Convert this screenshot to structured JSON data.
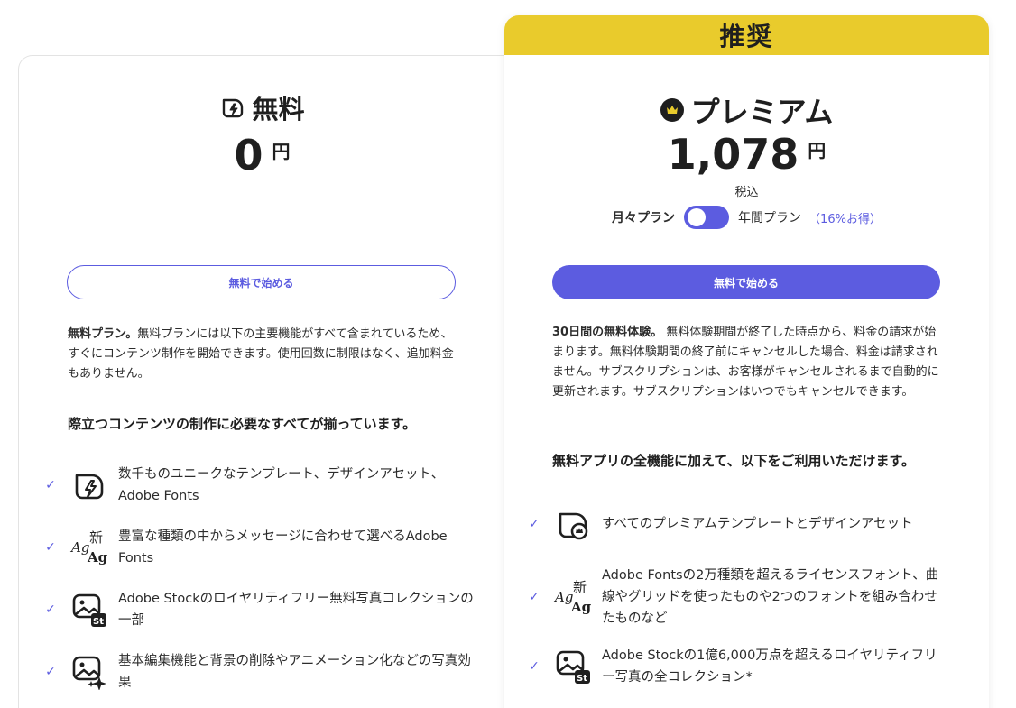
{
  "free": {
    "title": "無料",
    "price": "0",
    "currency": "円",
    "cta": "無料で始める",
    "desc_lead": "無料プラン。",
    "desc_body": "無料プランには以下の主要機能がすべて含まれているため、すぐにコンテンツ制作を開始できます。使用回数に制限はなく、追加料金もありません。",
    "features_heading": "際立つコンテンツの制作に必要なすべてが揃っています。",
    "features": [
      {
        "icon": "template-bolt-icon",
        "text": "数千ものユニークなテンプレート、デザインアセット、Adobe Fonts"
      },
      {
        "icon": "fonts-icon",
        "text": "豊富な種類の中からメッセージに合わせて選べるAdobe Fonts"
      },
      {
        "icon": "stock-photo-icon",
        "text": "Adobe Stockのロイヤリティフリー無料写真コレクションの一部"
      },
      {
        "icon": "photo-effects-icon",
        "text": "基本編集機能と背景の削除やアニメーション化などの写真効果"
      }
    ]
  },
  "premium": {
    "badge": "推奨",
    "title": "プレミアム",
    "price": "1,078",
    "currency": "円",
    "tax": "税込",
    "toggle_monthly": "月々プラン",
    "toggle_yearly": "年間プラン",
    "toggle_saving": "（16%お得）",
    "cta": "無料で始める",
    "desc_lead": "30日間の無料体験。",
    "desc_body": " 無料体験期間が終了した時点から、料金の請求が始まります。無料体験期間の終了前にキャンセルした場合、料金は請求されません。サブスクリプションは、お客様がキャンセルされるまで自動的に更新されます。サブスクリプションはいつでもキャンセルできます。",
    "features_heading": "無料アプリの全機能に加えて、以下をご利用いただけます。",
    "features": [
      {
        "icon": "premium-template-icon",
        "text": "すべてのプレミアムテンプレートとデザインアセット"
      },
      {
        "icon": "fonts-icon",
        "text": "Adobe Fontsの2万種類を超えるライセンスフォント、曲線やグリッドを使ったものや2つのフォントを組み合わせたものなど"
      },
      {
        "icon": "stock-photo-icon",
        "text": "Adobe Stockの1億6,000万点を超えるロイヤリティフリー写真の全コレクション*"
      }
    ]
  },
  "colors": {
    "accent": "#5c5ce0",
    "banner": "#e9cb2c",
    "text": "#2c2c2c"
  }
}
